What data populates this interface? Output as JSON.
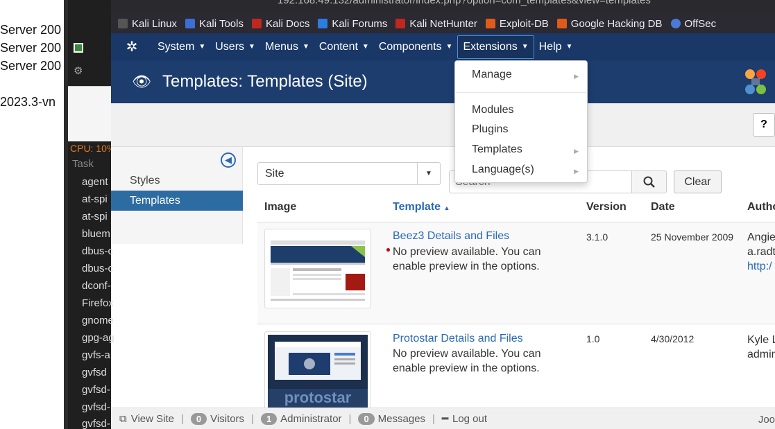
{
  "background_left": {
    "lines": [
      "Server 200",
      "Server 200",
      "Server 200",
      "2023.3-vn"
    ]
  },
  "task_panel": {
    "cpu": "CPU: 10%",
    "task_header": "Task",
    "rows": [
      "agent",
      "at-spi",
      "at-spi",
      "bluem",
      "dbus-c",
      "dbus-c",
      "dconf-",
      "Firefox",
      "gnome",
      "gpg-ag",
      "gvfs-a",
      "gvfsd",
      "gvfsd-",
      "gvfsd-",
      "gvfsd-"
    ]
  },
  "browser": {
    "address": "192.168.49.132/administrator/index.php?option=com_templates&view=templates",
    "zoom": "120%",
    "bookmarks": [
      {
        "label": "Kali Linux",
        "color": "#555"
      },
      {
        "label": "Kali Tools",
        "color": "#3b6fd4"
      },
      {
        "label": "Kali Docs",
        "color": "#c0281f"
      },
      {
        "label": "Kali Forums",
        "color": "#2a7de1"
      },
      {
        "label": "Kali NetHunter",
        "color": "#c0281f"
      },
      {
        "label": "Exploit-DB",
        "color": "#e05a1a"
      },
      {
        "label": "Google Hacking DB",
        "color": "#e05a1a"
      },
      {
        "label": "OffSec",
        "color": "#4a7ad8"
      }
    ]
  },
  "nav": {
    "items": [
      "System",
      "Users",
      "Menus",
      "Content",
      "Components",
      "Extensions",
      "Help"
    ],
    "active": "Extensions"
  },
  "page": {
    "title": "Templates: Templates (Site)"
  },
  "dropdown": {
    "items": [
      "Manage",
      "Modules",
      "Plugins",
      "Templates",
      "Language(s)"
    ]
  },
  "sidebar": {
    "items": [
      "Styles",
      "Templates"
    ],
    "active": "Templates"
  },
  "filters": {
    "client": "Site",
    "search_placeholder": "Search",
    "clear_label": "Clear"
  },
  "table": {
    "headers": [
      "Image",
      "Template",
      "Version",
      "Date",
      "Autho"
    ],
    "sort_indicator": "▲",
    "rows": [
      {
        "name": "Beez3 Details and Files",
        "note": "No preview available. You can enable preview in the options.",
        "version": "3.1.0",
        "date": "25 November 2009",
        "author_line1": "Angie",
        "author_line2": "a.radt",
        "author_line3": "http:/"
      },
      {
        "name": "Protostar Details and Files",
        "note": "No preview available. You can enable preview in the options.",
        "version": "1.0",
        "date": "4/30/2012",
        "author_line1": "Kyle L",
        "author_line2": "admin"
      }
    ]
  },
  "statusbar": {
    "view_site": "View Site",
    "visitors_count": "0",
    "visitors": "Visitors",
    "admin_count": "1",
    "admin": "Administrator",
    "messages_count": "0",
    "messages": "Messages",
    "logout": "Log out",
    "right": "Joo"
  }
}
